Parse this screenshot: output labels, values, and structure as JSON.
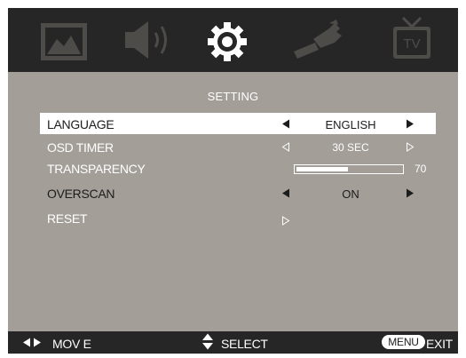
{
  "tabs": [
    {
      "icon": "picture-icon",
      "active": false
    },
    {
      "icon": "speaker-icon",
      "active": false
    },
    {
      "icon": "gear-icon",
      "active": true
    },
    {
      "icon": "wrench-icon",
      "active": false
    },
    {
      "icon": "tv-icon",
      "label": "TV",
      "active": false
    }
  ],
  "section_title": "SETTING",
  "rows": [
    {
      "label": "LANGUAGE",
      "value": "ENGLISH",
      "control": "selector",
      "selected": true
    },
    {
      "label": "OSD TIMER",
      "value": "30 SEC",
      "control": "selector"
    },
    {
      "label": "TRANSPARENCY",
      "value": "70",
      "control": "slider",
      "level_percent": 70
    },
    {
      "label": "OVERSCAN",
      "value": "ON",
      "control": "selector"
    },
    {
      "label": "RESET",
      "control": "action"
    }
  ],
  "footer": {
    "move_label": "MOV E",
    "select_label": "SELECT",
    "menu_key": "MENU",
    "exit_label": "EXIT"
  },
  "colors": {
    "panel": "#a39e98",
    "bar": "#262626",
    "icon_inactive": "#4e4c49",
    "icon_active": "#ffffff",
    "highlight": "#ffffff"
  }
}
